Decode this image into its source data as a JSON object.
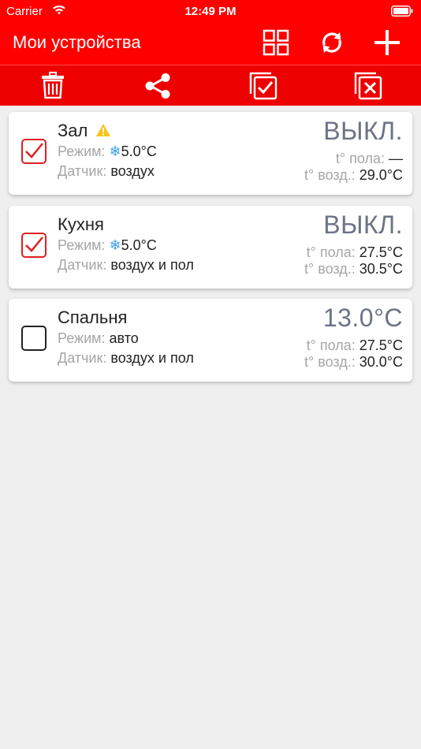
{
  "status_bar": {
    "carrier": "Carrier",
    "time": "12:49 PM"
  },
  "header": {
    "title": "Мои устройства"
  },
  "icons": {
    "grid": "grid-icon",
    "refresh": "refresh-icon",
    "add": "plus-icon",
    "trash": "trash-icon",
    "share": "share-icon",
    "select_all": "select-all-icon",
    "deselect_all": "deselect-all-icon"
  },
  "colors": {
    "header": "#ff0000",
    "checkbox": "#e02020",
    "status": "#6c7386",
    "snow": "#3aa0e6",
    "warning": "#f5c518"
  },
  "labels": {
    "mode": "Режим:",
    "sensor": "Датчик:",
    "floor_temp": "t° пола:",
    "air_temp": "t° возд.:"
  },
  "devices": [
    {
      "name": "Зал",
      "checked": true,
      "warning": true,
      "mode": "5.0°C",
      "mode_snow": true,
      "sensor": "воздух",
      "status": "ВЫКЛ.",
      "floor": "—",
      "air": "29.0°C"
    },
    {
      "name": "Кухня",
      "checked": true,
      "warning": false,
      "mode": "5.0°C",
      "mode_snow": true,
      "sensor": "воздух и пол",
      "status": "ВЫКЛ.",
      "floor": "27.5°C",
      "air": "30.5°C"
    },
    {
      "name": "Спальня",
      "checked": false,
      "warning": false,
      "mode": "авто",
      "mode_snow": false,
      "sensor": "воздух и пол",
      "status": "13.0°C",
      "floor": "27.5°C",
      "air": "30.0°C"
    }
  ]
}
